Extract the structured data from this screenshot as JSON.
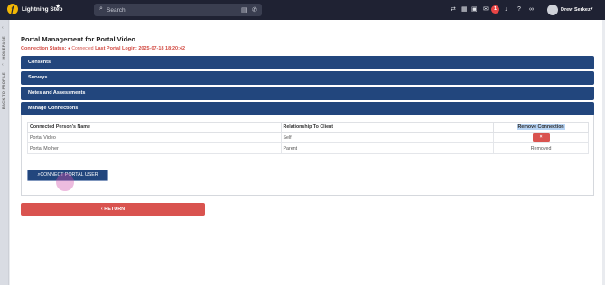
{
  "topbar": {
    "logo_glyph": "ƒ",
    "brand": "Lightning Step",
    "search_placeholder": "Search",
    "notification_count": "1",
    "user_name": "Drew Serkez"
  },
  "rail": {
    "homepage": "HOMEPAGE",
    "back_to_profile": "BACK TO PROFILE"
  },
  "page": {
    "title": "Portal Management for Portal Video",
    "status_label": "Connection Status:",
    "status_value": "Connected",
    "last_login_label": "Last Portal Login:",
    "last_login_value": "2025-07-18 18:20:42"
  },
  "accordion": [
    "Consents",
    "Surveys",
    "Notes and Assessments",
    "Manage Connections"
  ],
  "table": {
    "headers": [
      "Connected Person's Name",
      "Relationship To Client",
      "Remove Connection"
    ],
    "rows": [
      {
        "name": "Portal Video",
        "relationship": "Self",
        "action": "×"
      },
      {
        "name": "Portal Mother",
        "relationship": "Parent",
        "action": "Removed"
      }
    ]
  },
  "buttons": {
    "connect": "CONNECT PORTAL USER",
    "return": "RETURN"
  },
  "colors": {
    "topbar": "#1f2233",
    "accordion": "#22467d",
    "danger": "#d9534f",
    "status": "#d24b43"
  }
}
